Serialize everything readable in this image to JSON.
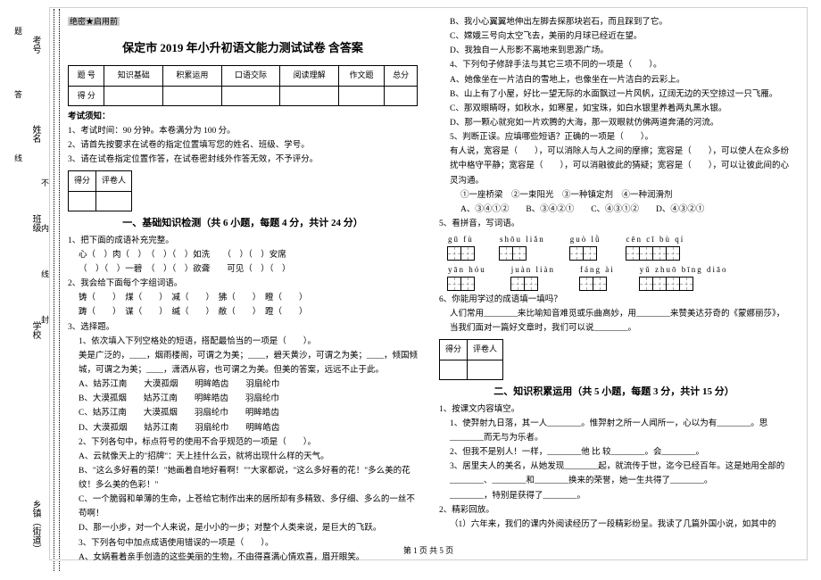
{
  "meta": {
    "secret": "绝密★启用前",
    "title": "保定市 2019 年小升初语文能力测试试卷 含答案",
    "footer": "第 1 页 共 5 页"
  },
  "margin": {
    "labels": [
      "考号",
      "姓名",
      "班级",
      "学校",
      "乡镇（街道）"
    ],
    "hint": "不 内 线 封",
    "note": "题 答 线"
  },
  "scoreHeader": [
    "题 号",
    "知识基础",
    "积累运用",
    "口语交际",
    "阅读理解",
    "作文题",
    "总分"
  ],
  "scoreRow": "得 分",
  "notice": {
    "head": "考试须知：",
    "items": [
      "1、考试时间：90 分钟。本卷满分为 100 分。",
      "2、请首先按要求在试卷的指定位置填写您的姓名、班级、学号。",
      "3、请在试卷指定位置作答，在试卷密封线外作答无效，不予评分。"
    ]
  },
  "scorebox": [
    "得分",
    "评卷人"
  ],
  "sec1": {
    "title": "一、基础知识检测（共 6 小题，每题 4 分，共计 24 分）",
    "q1": {
      "stem": "1、把下面的成语补充完整。",
      "lines": [
        "心（　）肉（　）　（　）（　）如洗　　（　）（　）安席",
        "（　）（　）一碧　（　）（　）欲聋　　可见（　）（　）"
      ]
    },
    "q2": {
      "stem": "2、我会给下面每个字组词语。",
      "lines": [
        "铸（　　）　煤（　　）　减（　　）　狒（　　）　瞪（　　）",
        "踌（　　）　谋（　　）　缄（　　）　敝（　　）　蹬（　　）"
      ]
    },
    "q3": {
      "stem": "3、选择题。",
      "p1": {
        "stem": "1、依次填入下列空格处的短语，搭配最恰当的一项是（　　）。",
        "text": "美是广泛的，____，烟雨楼阁，可谓之为美；____，碧天黄沙，可谓之为美；____，倾国倾城，可谓之为美；____，潇洒从容，也可谓之为美。但美的答案，远远不止于此。",
        "opts": [
          "A、姑苏江南　　大漠孤烟　　明眸皓齿　　羽扇纶巾",
          "B、大漠孤烟　　姑苏江南　　明眸皓齿　　羽扇纶巾",
          "C、姑苏江南　　大漠孤烟　　羽扇纶巾　　明眸皓齿",
          "D、大漠孤烟　　姑苏江南　　羽扇纶巾　　明眸皓齿"
        ]
      },
      "p2": {
        "stem": "2、下列各句中，标点符号的使用不合乎规范的一项是（　　）。",
        "opts": [
          "A、云就像天上的\"招牌\"：天上挂什么云，就将出现什么样的天气。",
          "B、\"这么多好看的菜！\"她画着自地好看啊！\"\"大家都说，\"这么多好看的花！\"多么美的花纹！多么美的色彩！\"",
          "C、一个脆弱和单薄的生命，上苍给它制作出来的居所却有多精致、多仔细、多么的一丝不苟啊！",
          "D、那一小步，对一个人来说，是小小的一步；对整个人类来说，是巨大的飞跃。"
        ]
      },
      "p3": {
        "stem": "3、下列各句中加点成语使用错误的一项是（　　）。",
        "a": "A、女娲看着亲手创造的这些美丽的生物，不由得喜满心情欢喜，眉开眼笑。"
      }
    }
  },
  "col2": {
    "opts3": [
      "B、我小心翼翼地伸出左脚去探那块岩石，而且踩到了它。",
      "C、嫦娥三号向太空飞去，美丽的月球已经近在望。",
      "D、我独自一人形影不离地来到思源广场。"
    ],
    "q4": {
      "stem": "4、下列句子修辞手法与其它三项不同的一项是（　　）。",
      "opts": [
        "A、她像坐在一片洁白的雪地上，也像坐在一片洁白的云彩上。",
        "B、山上有了小屋，好比一望无际的水面飘过一片风帆，辽阔无边的天空掠过一只飞雁。",
        "C、那双眼睛呀，如秋水，如寒星，如宝珠，如白水银里养着两丸黑水银。",
        "D、那一颗心就宛如一片欢腾的大海，那一双眼就仿佛两道奔涌的河流。"
      ]
    },
    "q5": {
      "stem": "5、判断正误。应填哪些短语？正确的一项是（　　）。",
      "text": "有人说，宽容是（　　），可以消除人与人之间的摩擦；宽容是（　　），可以使人在众多纷扰中格守平静；宽容是（　　），可以消融彼此的猜疑；宽容是（　　），可以让彼此间的心灵沟通。",
      "choices": "①一座桥梁　②一束阳光　③一种镇定剂　④一种润滑剂",
      "opts": "A、③④①②　　B、③④②①　　C、④③①②　　D、④③②①"
    },
    "q6": {
      "stem": "5、看拼音，写词语。",
      "row1": [
        {
          "py": "gū  fù"
        },
        {
          "py": "shōu liǎn"
        },
        {
          "py": "guò  lǜ"
        },
        {
          "py": "cēn  cī  bù  qí"
        }
      ],
      "row2": [
        {
          "py": "yān  hóu"
        },
        {
          "py": "juàn liàn"
        },
        {
          "py": "fáng  ài"
        },
        {
          "py": "yǔ zhuō bīng diāo"
        }
      ]
    },
    "q7": {
      "stem": "6、你能用学过的成语填一填吗？",
      "text": "人们常用________来比喻知音难觅或乐曲高妙，用________来赞美达芬奇的《蒙娜丽莎》，当我们面对一篇好文章时，我们可以说________。"
    },
    "sec2": {
      "title": "二、知识积累运用（共 5 小题，每题 3 分，共计 15 分）",
      "q1": {
        "stem": "1、按课文内容填空。",
        "lines": [
          "1、使羿射九日落，其一人________。惟羿射之所一人闻所一，心以为有________。思________而无与为乐者。",
          "2、但我不是别人！一样，________他 比 较________。会________。",
          "3、居里夫人的美名，从她发现________起，就流传于世，迄今已经百年。这是她用全部的________、________和________换来的荣誉，她一生共得了________。",
          "________，特别是获得了________。"
        ]
      },
      "q2": {
        "stem": "2、精彩回放。",
        "line": "（1）六年来，我们的课内外阅读经历了一段精彩纷呈。我读了几篇外国小说，如其中的"
      }
    }
  }
}
